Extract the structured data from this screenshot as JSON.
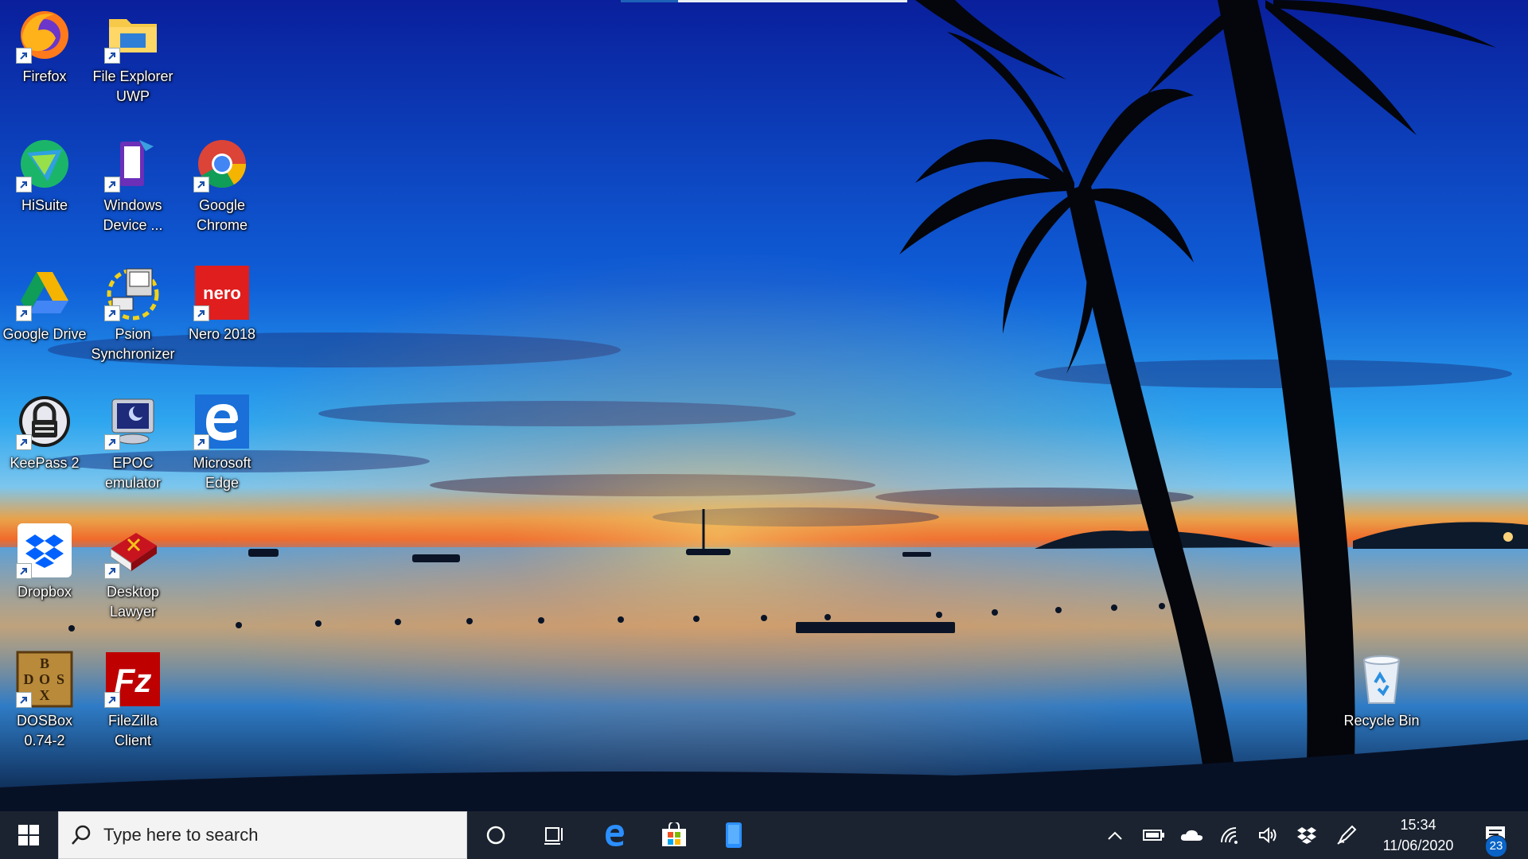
{
  "desktop": {
    "icons": [
      {
        "id": "firefox",
        "label": "Firefox"
      },
      {
        "id": "file-explorer-uwp",
        "label": "File Explorer UWP"
      },
      {
        "id": "hisuite",
        "label": "HiSuite"
      },
      {
        "id": "windows-device",
        "label": "Windows Device ..."
      },
      {
        "id": "google-chrome",
        "label": "Google Chrome"
      },
      {
        "id": "google-drive",
        "label": "Google Drive"
      },
      {
        "id": "psion-synchronizer",
        "label": "Psion Synchronizer"
      },
      {
        "id": "nero-2018",
        "label": "Nero 2018"
      },
      {
        "id": "keepass-2",
        "label": "KeePass 2"
      },
      {
        "id": "epoc-emulator",
        "label": "EPOC emulator"
      },
      {
        "id": "microsoft-edge",
        "label": "Microsoft Edge"
      },
      {
        "id": "dropbox",
        "label": "Dropbox"
      },
      {
        "id": "desktop-lawyer",
        "label": "Desktop Lawyer"
      },
      {
        "id": "dosbox",
        "label": "DOSBox 0.74-2"
      },
      {
        "id": "filezilla-client",
        "label": "FileZilla Client"
      },
      {
        "id": "recycle-bin",
        "label": "Recycle Bin"
      }
    ],
    "nero_logo_text": "nero",
    "dosbox_logo_text": [
      "B",
      "D",
      "O",
      "S",
      "X"
    ],
    "filezilla_logo_text": "Fz"
  },
  "taskbar": {
    "search_placeholder": "Type here to search",
    "pinned": [
      "cortana-icon",
      "task-view-icon",
      "edge-icon",
      "store-icon",
      "phone-icon"
    ],
    "tray": [
      "chevron-up-icon",
      "battery-icon",
      "onedrive-icon",
      "wifi-icon",
      "volume-icon",
      "dropbox-tray-icon",
      "pen-icon"
    ],
    "time": "15:34",
    "date": "11/06/2020",
    "notification_count": "23"
  },
  "colors": {
    "taskbar": "#1b2330",
    "accent": "#0a64c8",
    "sky_top": "#0a2aa8",
    "horizon": "#f08a2a"
  }
}
